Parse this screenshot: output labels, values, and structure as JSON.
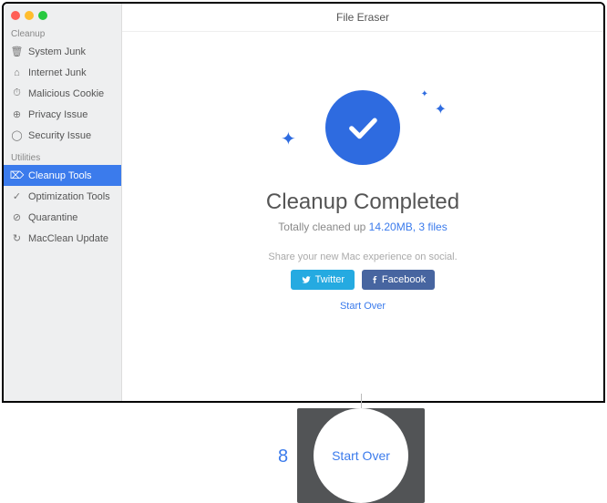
{
  "window": {
    "title": "File Eraser"
  },
  "sidebar": {
    "group1_title": "Cleanup",
    "group1": [
      {
        "label": "System Junk",
        "icon": "🗑"
      },
      {
        "label": "Internet Junk",
        "icon": "⌂"
      },
      {
        "label": "Malicious Cookie",
        "icon": "⏱"
      },
      {
        "label": "Privacy Issue",
        "icon": "⊕"
      },
      {
        "label": "Security Issue",
        "icon": "◯"
      }
    ],
    "group2_title": "Utilities",
    "group2": [
      {
        "label": "Cleanup Tools",
        "icon": "⌦"
      },
      {
        "label": "Optimization Tools",
        "icon": "✓"
      },
      {
        "label": "Quarantine",
        "icon": "⊘"
      },
      {
        "label": "MacClean Update",
        "icon": "↻"
      }
    ],
    "active": "Cleanup Tools"
  },
  "result": {
    "heading": "Cleanup Completed",
    "sub_prefix": "Totally cleaned up ",
    "sub_highlight": "14.20MB, 3 files",
    "share_line": "Share your new Mac experience on social.",
    "twitter": "Twitter",
    "facebook": "Facebook",
    "startover": "Start Over"
  },
  "callout": {
    "step": "8",
    "label": "Start Over"
  }
}
